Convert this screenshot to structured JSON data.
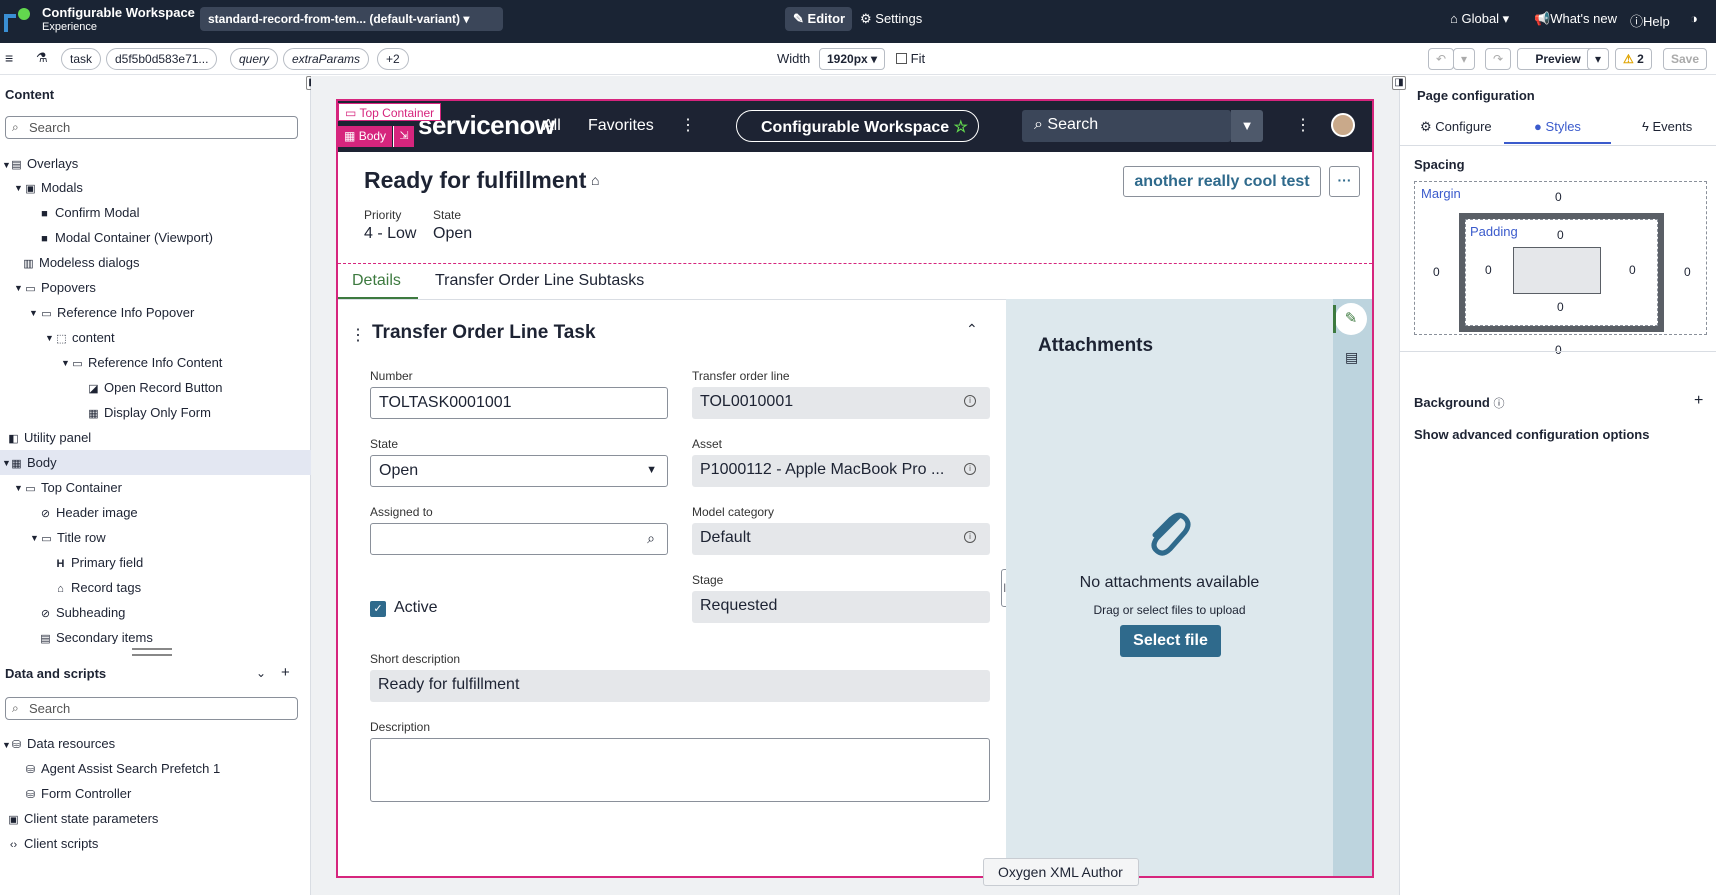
{
  "topbar": {
    "app_name": "Configurable Workspace",
    "app_sub": "Experience",
    "variant": "standard-record-from-tem... (default-variant)",
    "editor": "Editor",
    "settings": "Settings",
    "global": "Global",
    "whats_new": "What's new",
    "help": "Help"
  },
  "toolbar": {
    "params": [
      "task",
      "d5f5b0d583e71...",
      "query",
      "extraParams",
      "+2"
    ],
    "width_label": "Width",
    "width_value": "1920px",
    "fit_label": "Fit",
    "preview": "Preview",
    "warnings": "2",
    "save": "Save"
  },
  "content_panel": {
    "title": "Content",
    "search_placeholder": "Search",
    "tree": [
      "Overlays",
      "Modals",
      "Confirm Modal",
      "Modal Container (Viewport)",
      "Modeless dialogs",
      "Popovers",
      "Reference Info Popover",
      "content",
      "Reference Info Content",
      "Open Record Button",
      "Display Only Form",
      "Utility panel",
      "Body",
      "Top Container",
      "Header image",
      "Title row",
      "Primary field",
      "Record tags",
      "Subheading",
      "Secondary items"
    ]
  },
  "data_panel": {
    "title": "Data and scripts",
    "search_placeholder": "Search",
    "tree": [
      "Data resources",
      "Agent Assist Search Prefetch 1",
      "Form Controller",
      "Client state parameters",
      "Client scripts"
    ]
  },
  "canvas": {
    "top_container_tag": "Top Container",
    "body_tag": "Body",
    "nav": {
      "brand": "servicenow",
      "all": "All",
      "favorites": "Favorites",
      "workspace": "Configurable Workspace",
      "search": "Search"
    },
    "record": {
      "title": "Ready for fulfillment",
      "action_button": "another really cool test",
      "priority_label": "Priority",
      "priority_value": "4 - Low",
      "state_label": "State",
      "state_value": "Open",
      "tabs": [
        "Details",
        "Transfer Order Line Subtasks"
      ],
      "section_title": "Transfer Order Line Task",
      "fields": {
        "number_label": "Number",
        "number_value": "TOLTASK0001001",
        "tol_label": "Transfer order line",
        "tol_value": "TOL0010001",
        "state_label": "State",
        "state_value": "Open",
        "asset_label": "Asset",
        "asset_value": "P1000112 - Apple MacBook Pro ...",
        "assigned_label": "Assigned to",
        "assigned_value": "",
        "model_label": "Model category",
        "model_value": "Default",
        "stage_label": "Stage",
        "stage_value": "Requested",
        "active_label": "Active",
        "short_desc_label": "Short description",
        "short_desc_value": "Ready for fulfillment",
        "desc_label": "Description"
      }
    },
    "attachments": {
      "title": "Attachments",
      "empty": "No attachments available",
      "hint": "Drag or select files to upload",
      "button": "Select file"
    }
  },
  "right_panel": {
    "title": "Page configuration",
    "tabs": [
      "Configure",
      "Styles",
      "Events"
    ],
    "spacing": "Spacing",
    "margin": "Margin",
    "padding": "Padding",
    "zero": "0",
    "background": "Background",
    "advanced": "Show advanced configuration options"
  },
  "tooltip": "Oxygen XML Author"
}
